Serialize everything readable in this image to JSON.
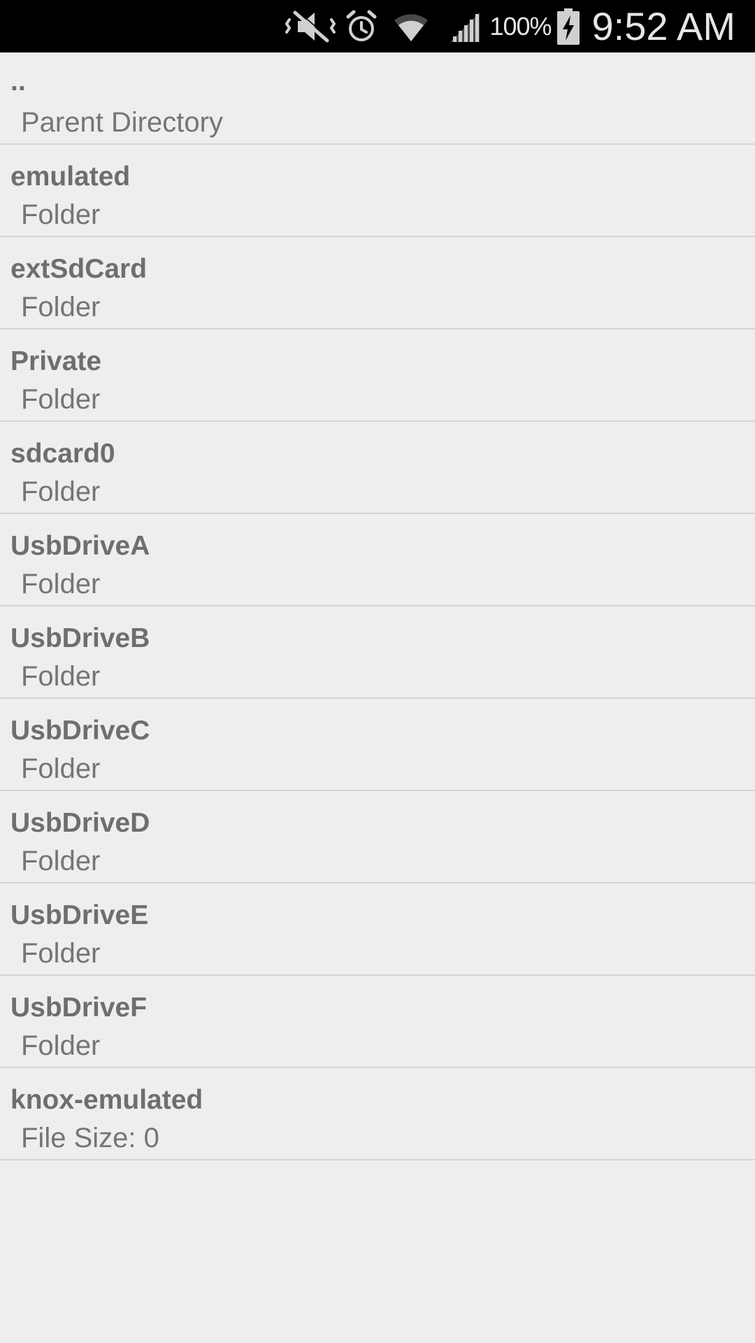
{
  "status_bar": {
    "battery_percent": "100%",
    "time": "9:52 AM",
    "icons": [
      "mute-vibrate-icon",
      "alarm-icon",
      "wifi-icon",
      "cell-signal-icon",
      "battery-charging-icon"
    ],
    "battery_level": 1.0
  },
  "file_list": {
    "items": [
      {
        "name": "..",
        "description": "Parent Directory"
      },
      {
        "name": "emulated",
        "description": "Folder"
      },
      {
        "name": "extSdCard",
        "description": "Folder"
      },
      {
        "name": "Private",
        "description": "Folder"
      },
      {
        "name": "sdcard0",
        "description": "Folder"
      },
      {
        "name": "UsbDriveA",
        "description": "Folder"
      },
      {
        "name": "UsbDriveB",
        "description": "Folder"
      },
      {
        "name": "UsbDriveC",
        "description": "Folder"
      },
      {
        "name": "UsbDriveD",
        "description": "Folder"
      },
      {
        "name": "UsbDriveE",
        "description": "Folder"
      },
      {
        "name": "UsbDriveF",
        "description": "Folder"
      },
      {
        "name": "knox-emulated",
        "description": "File Size: 0"
      }
    ]
  }
}
